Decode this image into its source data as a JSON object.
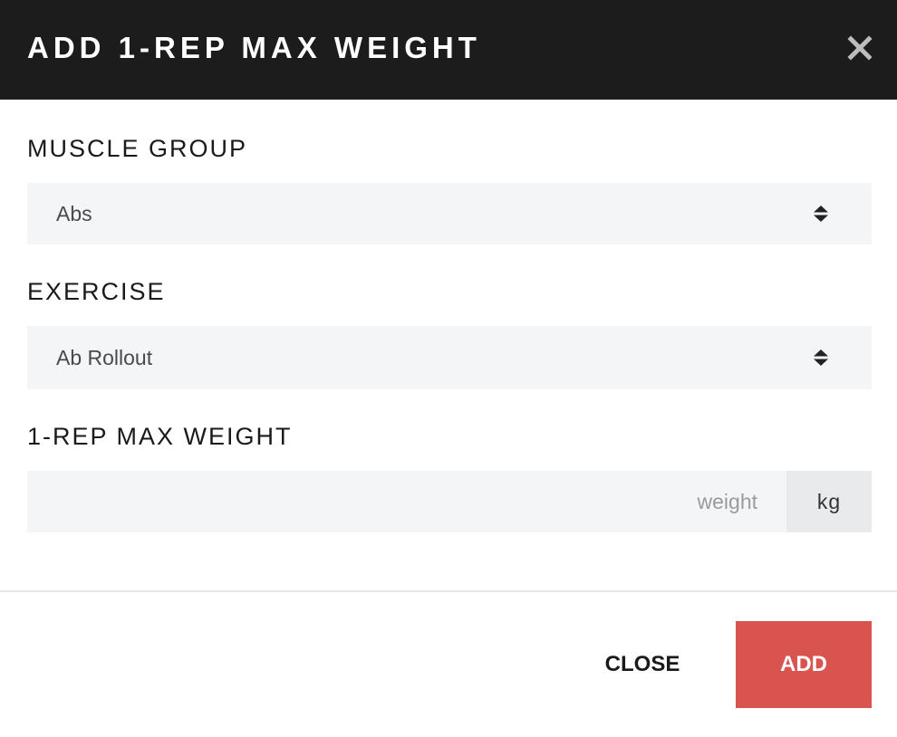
{
  "dialog": {
    "title": "ADD 1-REP MAX WEIGHT",
    "close_icon": "close-icon"
  },
  "form": {
    "muscle_group": {
      "label": "MUSCLE GROUP",
      "selected": "Abs"
    },
    "exercise": {
      "label": "EXERCISE",
      "selected": "Ab Rollout"
    },
    "weight": {
      "label": "1-REP MAX WEIGHT",
      "value": "",
      "placeholder": "weight",
      "unit": "kg"
    }
  },
  "footer": {
    "close_label": "CLOSE",
    "add_label": "ADD"
  },
  "colors": {
    "header_bg": "#1c1c1c",
    "accent": "#d9534f",
    "field_bg": "#f4f5f7"
  }
}
